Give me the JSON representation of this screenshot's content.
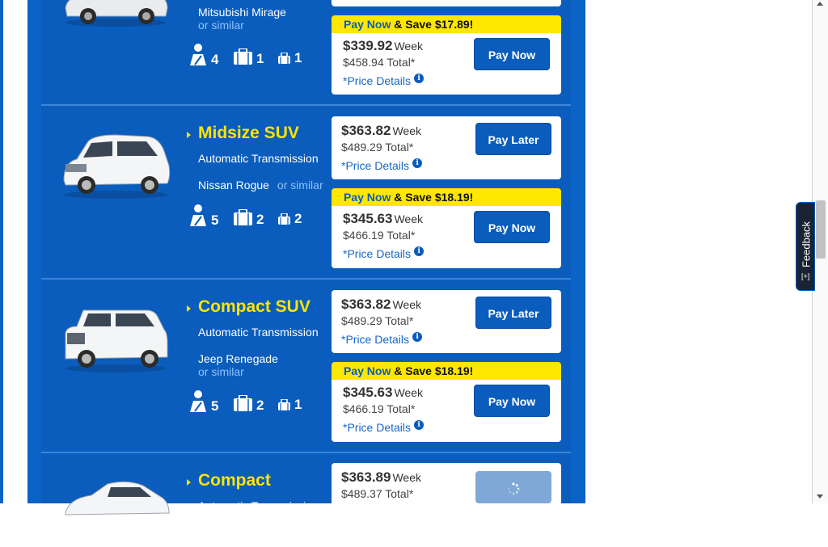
{
  "colors": {
    "brand_blue": "#0a5dbc",
    "title_yellow": "#ffe400",
    "save_yellow": "#ffe700"
  },
  "rows": [
    {
      "model": "Mitsubishi Mirage",
      "similar": "or similar",
      "passengers": "4",
      "large_bags": "1",
      "small_bags": "1",
      "pay_now": {
        "pay_now_label": "Pay Now",
        "save_label": "& Save $17.89!",
        "weekly": "$339.92",
        "week_label": "Week",
        "total": "$458.94 Total*",
        "details": "*Price Details",
        "info": "i",
        "button": "Pay Now"
      }
    },
    {
      "title": "Midsize SUV",
      "transmission": "Automatic Transmission",
      "model": "Nissan Rogue",
      "similar": "or similar",
      "passengers": "5",
      "large_bags": "2",
      "small_bags": "2",
      "pay_later": {
        "weekly": "$363.82",
        "week_label": "Week",
        "total": "$489.29 Total*",
        "details": "*Price Details",
        "info": "i",
        "button": "Pay Later"
      },
      "pay_now": {
        "pay_now_label": "Pay Now",
        "save_label": "& Save $18.19!",
        "weekly": "$345.63",
        "week_label": "Week",
        "total": "$466.19 Total*",
        "details": "*Price Details",
        "info": "i",
        "button": "Pay Now"
      }
    },
    {
      "title": "Compact SUV",
      "transmission": "Automatic Transmission",
      "model": "Jeep Renegade",
      "similar": "or similar",
      "passengers": "5",
      "large_bags": "2",
      "small_bags": "1",
      "pay_later": {
        "weekly": "$363.82",
        "week_label": "Week",
        "total": "$489.29 Total*",
        "details": "*Price Details",
        "info": "i",
        "button": "Pay Later"
      },
      "pay_now": {
        "pay_now_label": "Pay Now",
        "save_label": "& Save $18.19!",
        "weekly": "$345.63",
        "week_label": "Week",
        "total": "$466.19 Total*",
        "details": "*Price Details",
        "info": "i",
        "button": "Pay Now"
      }
    },
    {
      "title": "Compact",
      "transmission": "Automatic Transmission",
      "pay_later": {
        "weekly": "$363.89",
        "week_label": "Week",
        "total": "$489.37 Total*"
      }
    }
  ],
  "feedback": {
    "label": "Feedback",
    "symbol": "[+]"
  },
  "icons": [
    "passenger-icon",
    "large-bag-icon",
    "small-bag-icon",
    "info-icon",
    "loading-spinner-icon",
    "caret-right-icon"
  ]
}
